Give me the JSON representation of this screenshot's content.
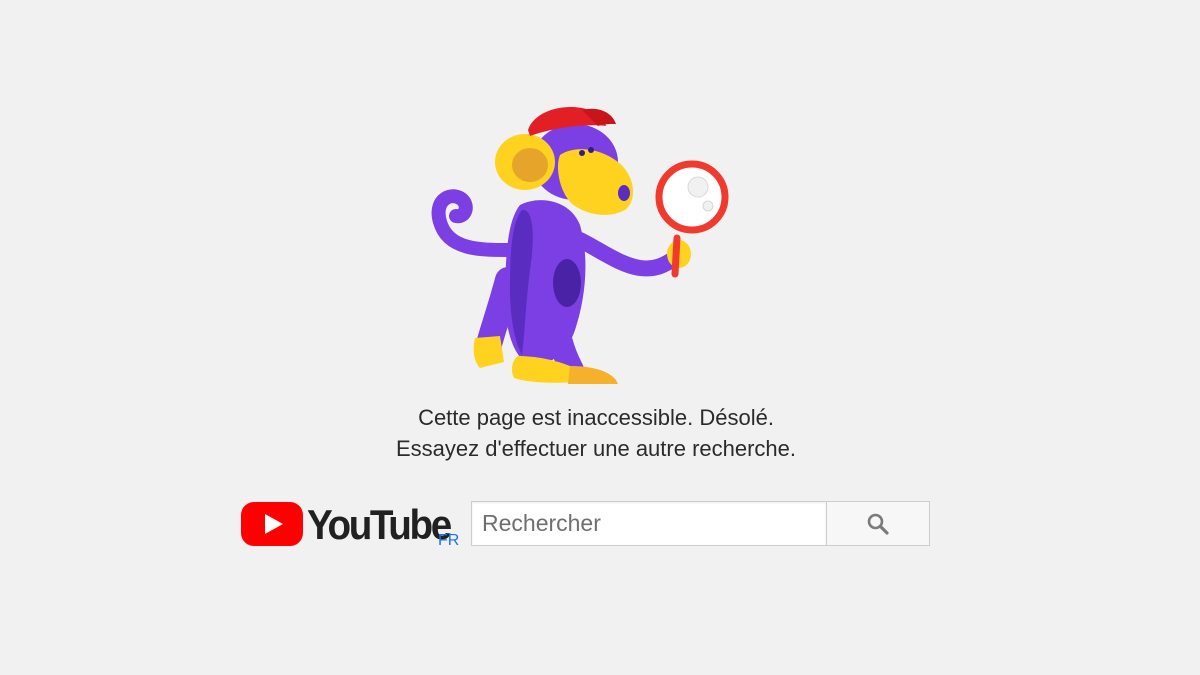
{
  "illustration": {
    "icon": "monkey-with-magnifying-glass-icon",
    "colors": {
      "body": "#7b3fe4",
      "body_shadow": "#5b2cc0",
      "face": "#ffd21f",
      "cap": "#e31f26",
      "magnifier": "#f03a2e"
    }
  },
  "error": {
    "line1": "Cette page est inaccessible. Désolé.",
    "line2": "Essayez d'effectuer une autre recherche."
  },
  "logo": {
    "icon": "youtube-play-icon",
    "wordmark": "YouTube",
    "country_code": "FR",
    "brand_color": "#ff0000"
  },
  "search": {
    "placeholder": "Rechercher",
    "value": "",
    "button_icon": "search-icon"
  }
}
